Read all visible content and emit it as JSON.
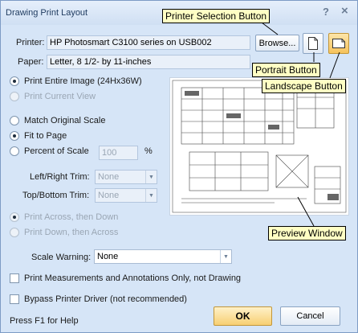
{
  "window": {
    "title": "Drawing Print Layout",
    "help_button": "?",
    "close_button": "×"
  },
  "printer": {
    "label": "Printer:",
    "value": "HP Photosmart C3100 series on USB002",
    "browse_label": "Browse..."
  },
  "paper": {
    "label": "Paper:",
    "value": "Letter, 8 1/2- by 11-inches"
  },
  "print_range": {
    "entire_image": "Print Entire Image (24Hx36W)",
    "current_view": "Print Current View"
  },
  "scale": {
    "match_original": "Match Original Scale",
    "fit_to_page": "Fit to Page",
    "percent_of_scale": "Percent of Scale",
    "percent_value": "100",
    "percent_unit": "%"
  },
  "trim": {
    "left_right_label": "Left/Right Trim:",
    "left_right_value": "None",
    "top_bottom_label": "Top/Bottom Trim:",
    "top_bottom_value": "None"
  },
  "order": {
    "across_then_down": "Print Across, then Down",
    "down_then_across": "Print Down, then Across"
  },
  "scale_warning": {
    "label": "Scale Warning:",
    "value": "None"
  },
  "options": {
    "measurements_only": "Print Measurements and Annotations Only, not Drawing",
    "bypass_driver": "Bypass Printer Driver (not recommended)"
  },
  "footer": {
    "help_text": "Press F1 for Help",
    "ok_label": "OK",
    "cancel_label": "Cancel"
  },
  "callouts": {
    "printer_selection": "Printer Selection Button",
    "portrait": "Portrait Button",
    "landscape": "Landscape Button",
    "preview": "Preview Window"
  },
  "colors": {
    "dialog_background": "#d6e5f7",
    "callout_background": "#ffffc4",
    "ok_button": "#f7cf73"
  }
}
